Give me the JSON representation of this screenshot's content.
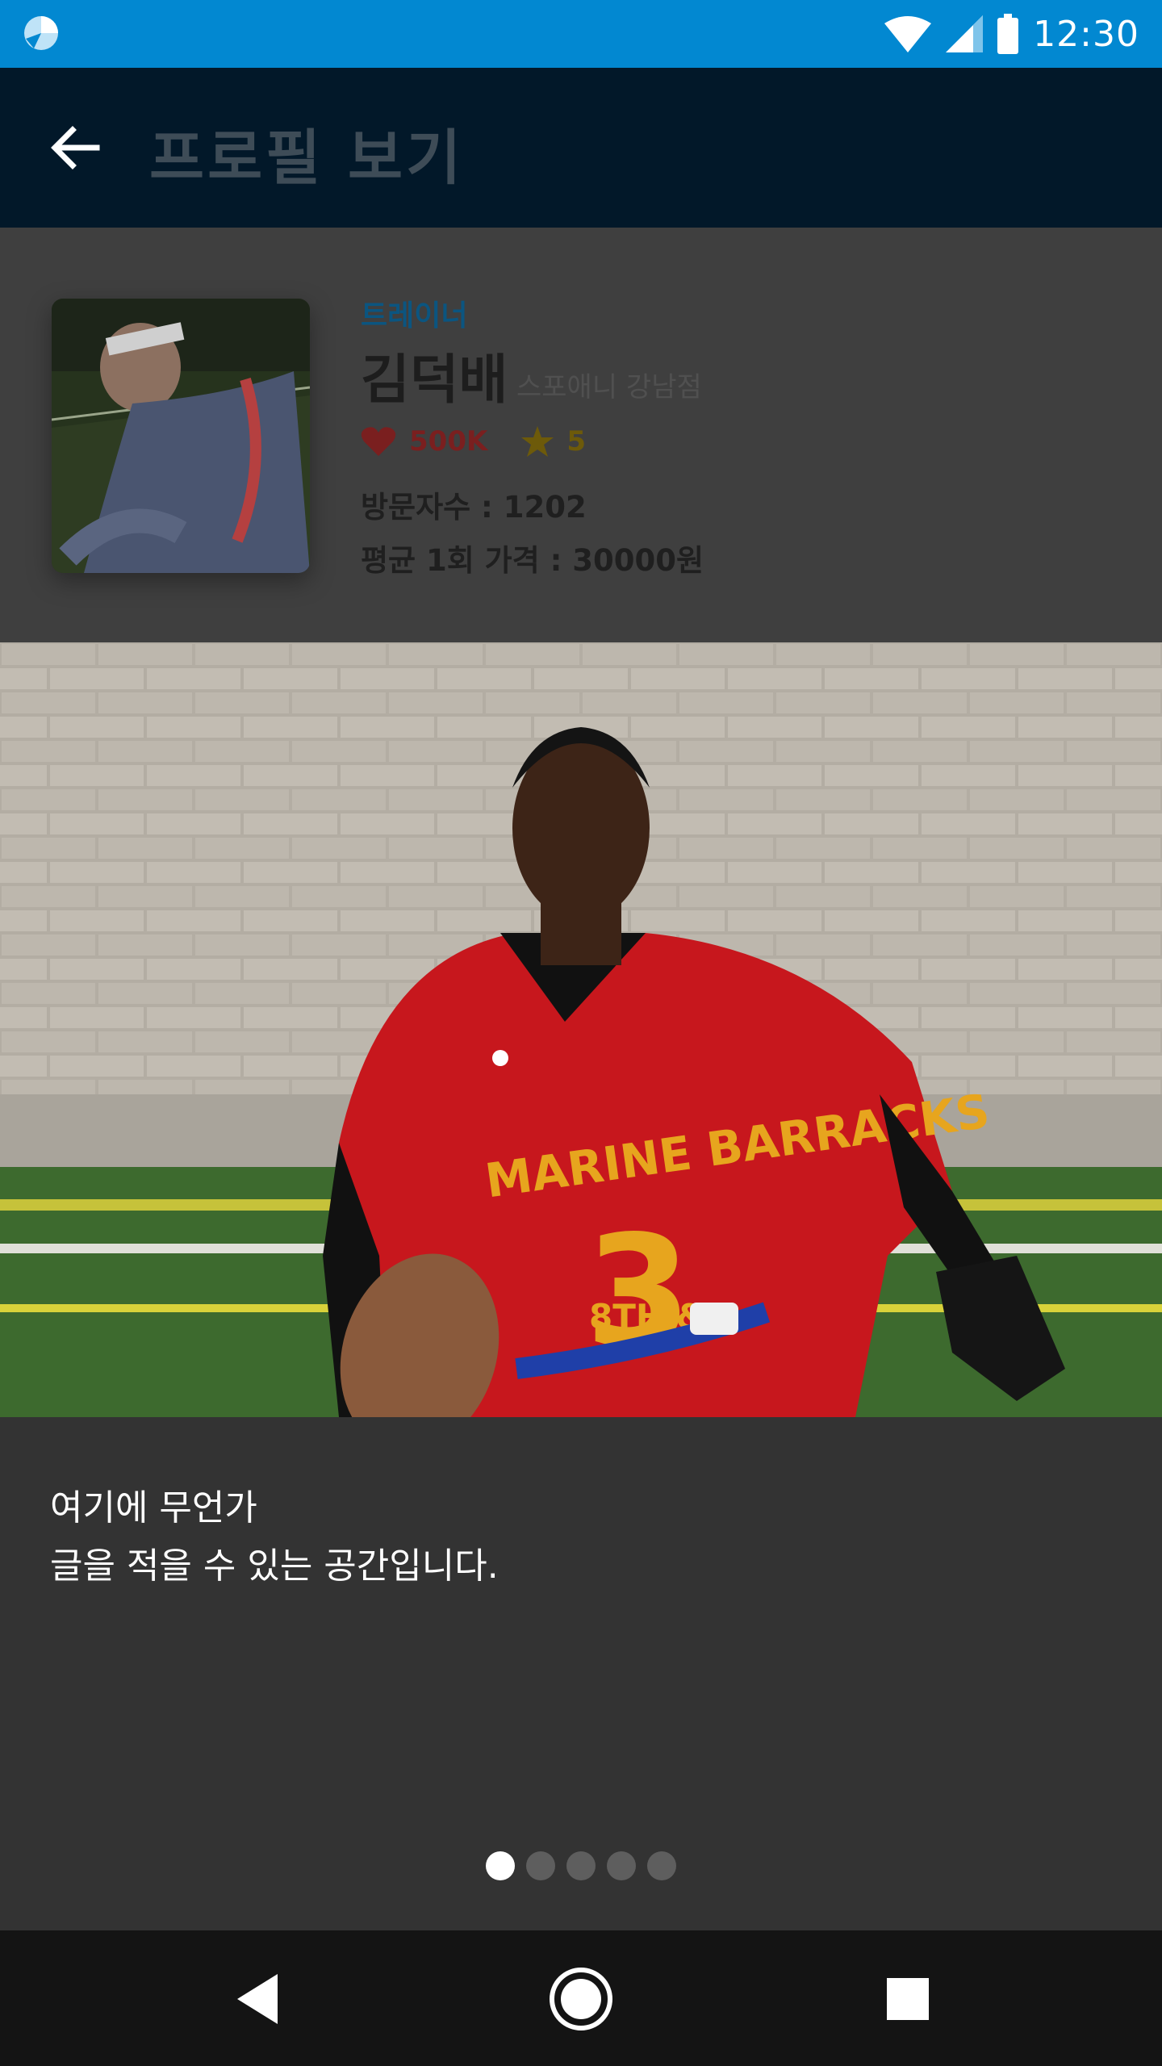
{
  "status_bar": {
    "time": "12:30",
    "icons": [
      "app-icon",
      "wifi-icon",
      "signal-icon",
      "battery-icon"
    ],
    "background": "#0288d1"
  },
  "app_bar": {
    "title": "프로필 보기",
    "background": "#021829",
    "back_icon": "arrow-left-icon"
  },
  "profile": {
    "role": "트레이너",
    "name": "김덕배",
    "branch": "스포애니 강남점",
    "likes": "500K",
    "rating": "5",
    "visitors": "방문자수 : 1202",
    "price": "평균 1회 가격 : 30000원"
  },
  "slide": {
    "jersey_text": "MARINE BARRACKS",
    "jersey_number": "3",
    "jersey_sub": "8TH & I"
  },
  "description": {
    "line1": "여기에 무언가",
    "line2": "글을 적을 수 있는 공간입니다."
  },
  "pager": {
    "count": 5,
    "active": 1
  },
  "nav_bar": {
    "icons": [
      "back-triangle-icon",
      "home-circle-icon",
      "recents-square-icon"
    ]
  }
}
